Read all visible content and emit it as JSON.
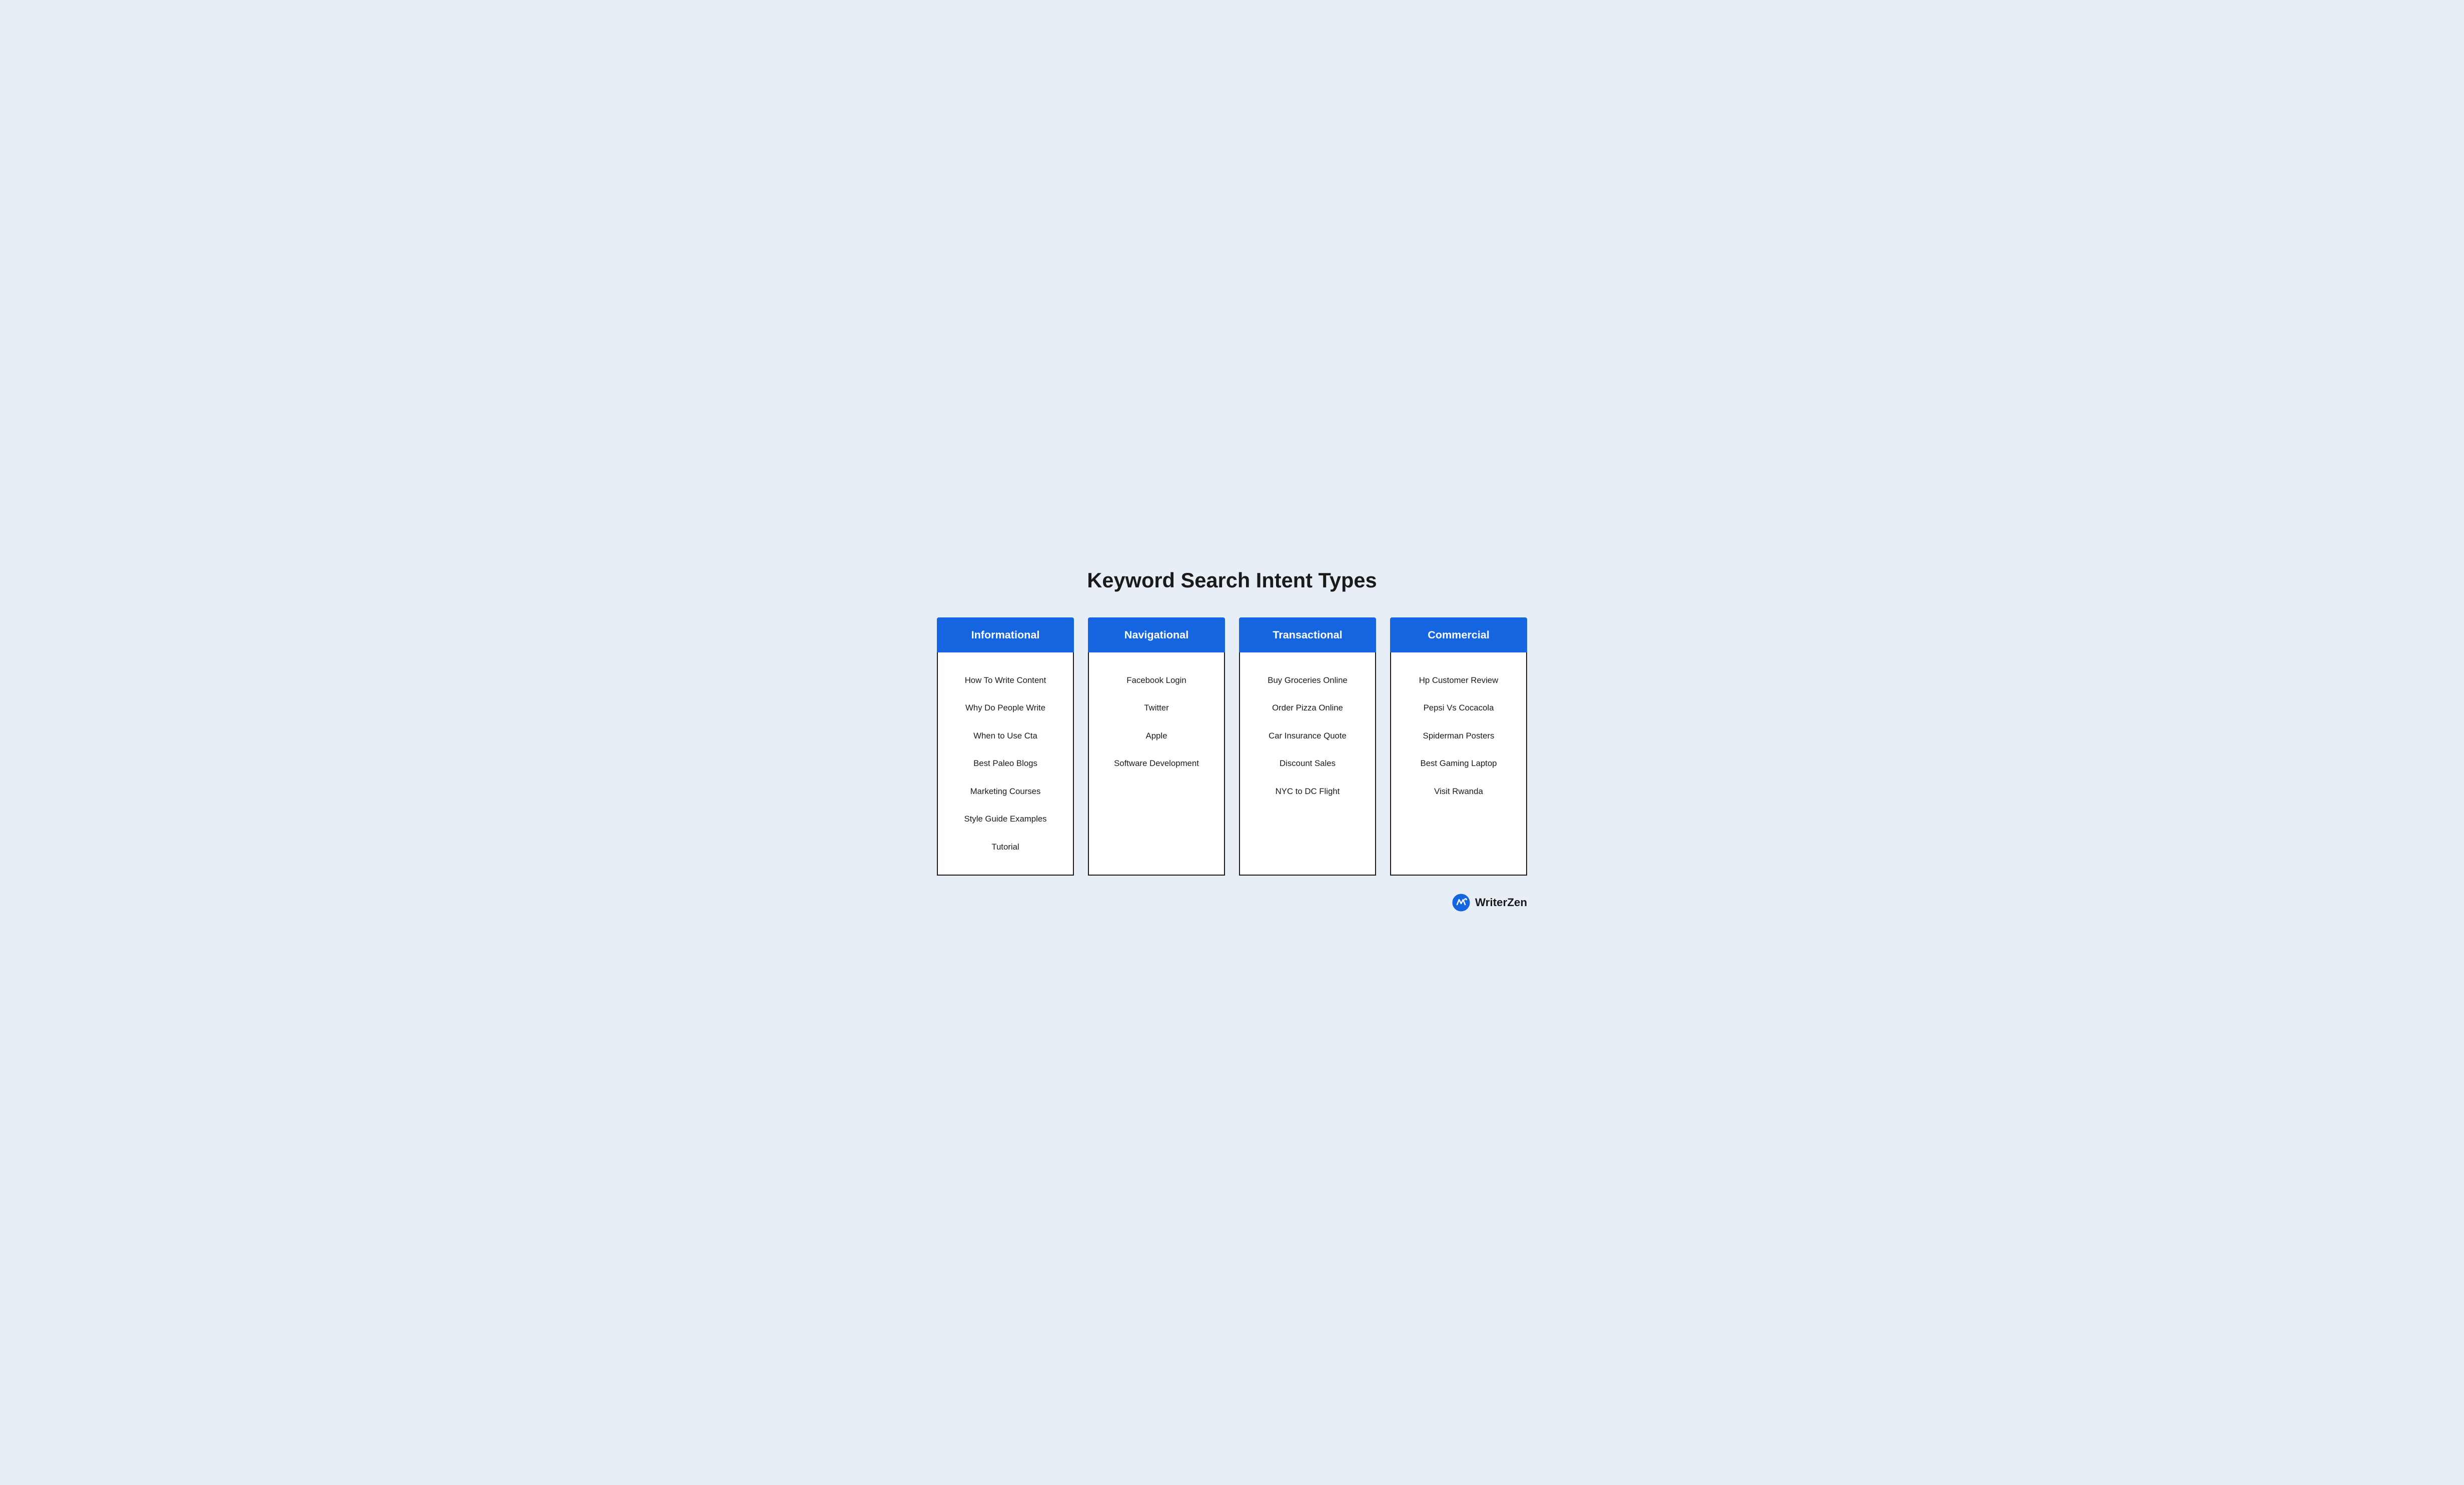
{
  "page": {
    "title": "Keyword Search Intent Types",
    "background": "#e8eef5"
  },
  "columns": [
    {
      "id": "informational",
      "header": "Informational",
      "items": [
        "How To Write Content",
        "Why Do People Write",
        "When to Use Cta",
        "Best Paleo Blogs",
        "Marketing Courses",
        "Style Guide Examples",
        "Tutorial"
      ]
    },
    {
      "id": "navigational",
      "header": "Navigational",
      "items": [
        "Facebook Login",
        "Twitter",
        "Apple",
        "Software Development"
      ]
    },
    {
      "id": "transactional",
      "header": "Transactional",
      "items": [
        "Buy Groceries Online",
        "Order Pizza Online",
        "Car Insurance Quote",
        "Discount Sales",
        "NYC to DC Flight"
      ]
    },
    {
      "id": "commercial",
      "header": "Commercial",
      "items": [
        "Hp Customer Review",
        "Pepsi Vs Cocacola",
        "Spiderman Posters",
        "Best Gaming Laptop",
        "Visit Rwanda"
      ]
    }
  ],
  "branding": {
    "name": "WriterZen"
  }
}
